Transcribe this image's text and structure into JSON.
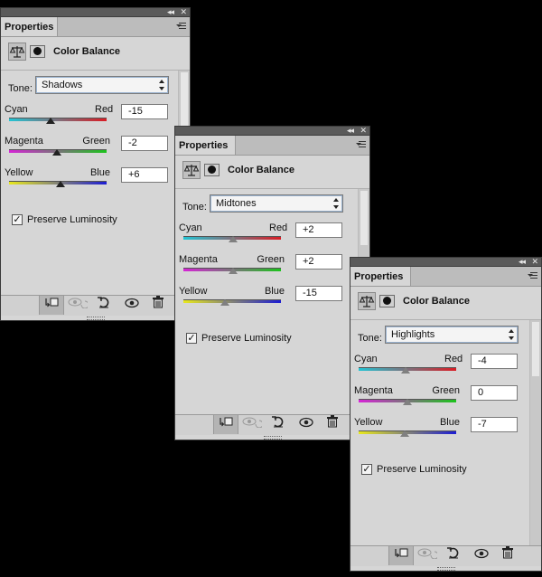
{
  "panels": [
    {
      "tab": "Properties",
      "title": "Color Balance",
      "tone_label": "Tone:",
      "tone": "Shadows",
      "sliders": [
        {
          "left": "Cyan",
          "right": "Red",
          "value": "-15",
          "position": 0.43
        },
        {
          "left": "Magenta",
          "right": "Green",
          "value": "-2",
          "position": 0.49
        },
        {
          "left": "Yellow",
          "right": "Blue",
          "value": "+6",
          "position": 0.53
        }
      ],
      "preserve_label": "Preserve Luminosity",
      "preserve_checked": true
    },
    {
      "tab": "Properties",
      "title": "Color Balance",
      "tone_label": "Tone:",
      "tone": "Midtones",
      "sliders": [
        {
          "left": "Cyan",
          "right": "Red",
          "value": "+2",
          "position": 0.51
        },
        {
          "left": "Magenta",
          "right": "Green",
          "value": "+2",
          "position": 0.51
        },
        {
          "left": "Yellow",
          "right": "Blue",
          "value": "-15",
          "position": 0.43
        }
      ],
      "preserve_label": "Preserve Luminosity",
      "preserve_checked": true
    },
    {
      "tab": "Properties",
      "title": "Color Balance",
      "tone_label": "Tone:",
      "tone": "Highlights",
      "sliders": [
        {
          "left": "Cyan",
          "right": "Red",
          "value": "-4",
          "position": 0.48
        },
        {
          "left": "Magenta",
          "right": "Green",
          "value": "0",
          "position": 0.5
        },
        {
          "left": "Yellow",
          "right": "Blue",
          "value": "-7",
          "position": 0.47
        }
      ],
      "preserve_label": "Preserve Luminosity",
      "preserve_checked": true
    }
  ],
  "colors": {
    "panel_bg": "#d6d6d6",
    "titlebar": "#5a5a5a",
    "cyan": "#22c4d4",
    "red": "#da1c24",
    "magenta": "#d624d6",
    "green": "#1cc41c",
    "yellow": "#e8e81c",
    "blue": "#1c1cd4"
  },
  "icons": {
    "collapse": "double-chevron-left-icon",
    "close": "close-icon",
    "panel_menu": "panel-menu-icon",
    "adjustment": "balance-scale-icon",
    "mask": "layer-mask-icon",
    "clip": "clip-to-layer-icon",
    "view_previous": "view-previous-state-icon",
    "reset": "reset-icon",
    "visibility": "eye-icon",
    "delete": "trash-icon"
  }
}
